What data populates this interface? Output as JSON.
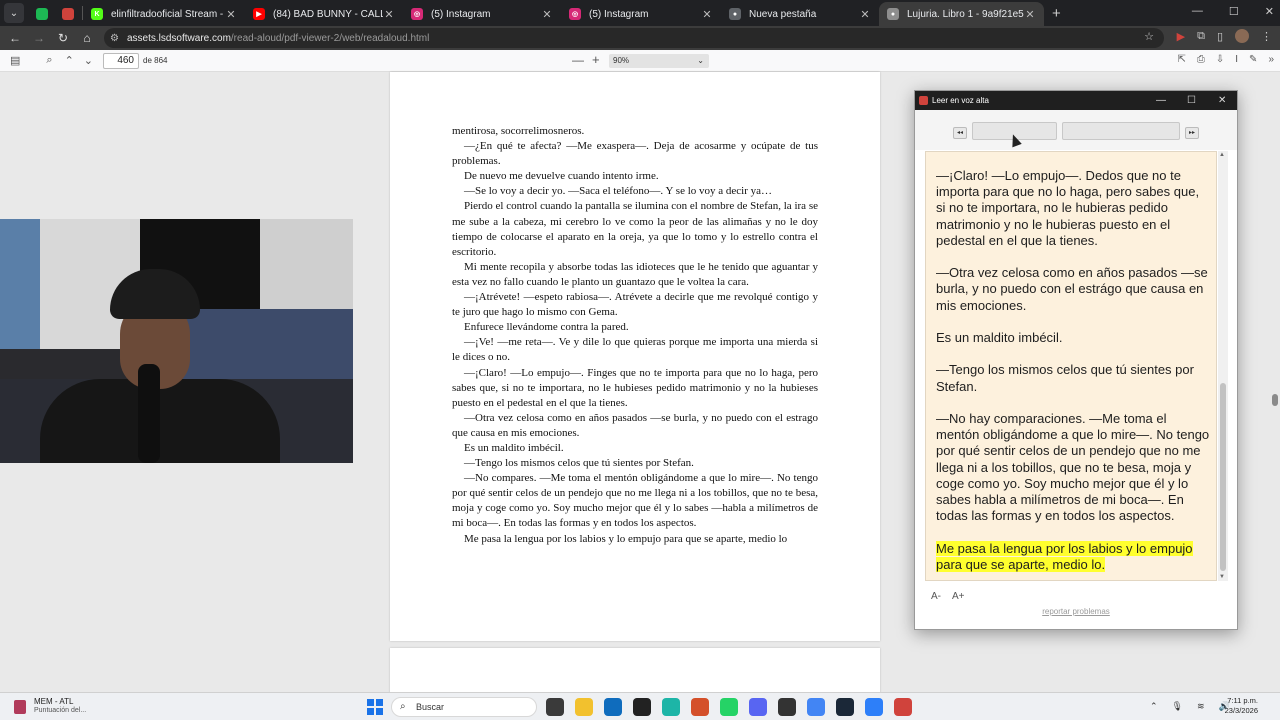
{
  "browser": {
    "tabs": [
      {
        "label": "elinfiltradooficial Stream - Wat",
        "fav_color": "#53fc18",
        "fav_glyph": "K",
        "active": false
      },
      {
        "label": "(84) BAD BUNNY - CALLAÍTA (C",
        "fav_color": "#ff0000",
        "fav_glyph": "▶",
        "active": false
      },
      {
        "label": "(5) Instagram",
        "fav_color": "#d62976",
        "fav_glyph": "◎",
        "active": false
      },
      {
        "label": "(5) Instagram",
        "fav_color": "#d62976",
        "fav_glyph": "◎",
        "active": false
      },
      {
        "label": "Nueva pestaña",
        "fav_color": "#5f6368",
        "fav_glyph": "●",
        "active": false
      },
      {
        "label": "Lujuria. Libro 1 - 9a9f21e5-01d",
        "fav_color": "#8e8e8e",
        "fav_glyph": "●",
        "active": true
      }
    ],
    "url_host": "assets.lsdsoftware.com",
    "url_path": "/read-aloud/pdf-viewer-2/web/readaloud.html"
  },
  "pdf_toolbar": {
    "page_current": "460",
    "page_total": "de 864",
    "zoom": "90%"
  },
  "document": {
    "paragraphs": [
      "mentirosa, socorrelimosneros.",
      "—¿En qué te afecta? —Me exaspera—. Deja de acosarme y ocúpate de tus problemas.",
      "De nuevo me devuelve cuando intento irme.",
      "—Se lo voy a decir yo. —Saca el teléfono—. Y se lo voy a decir ya…",
      "Pierdo el control cuando la pantalla se ilumina con el nombre de Stefan, la ira se me sube a la cabeza, mi cerebro lo ve como la peor de las alimañas y no le doy tiempo de colocarse el aparato en la oreja, ya que lo tomo y lo estrello contra el escritorio.",
      "Mi mente recopila y absorbe todas las idioteces que le he tenido que aguantar y esta vez no fallo cuando le planto un guantazo que le voltea la cara.",
      "—¡Atrévete! —espeto rabiosa—. Atrévete a decirle que me revolqué contigo y te juro que hago lo mismo con Gema.",
      "Enfurece llevándome contra la pared.",
      "—¡Ve! —me reta—. Ve y dile lo que quieras porque me importa una mierda si le dices o no.",
      "—¡Claro! —Lo empujo—. Finges que no te importa para que no lo haga, pero sabes que, si no te importara, no le hubieses pedido matrimonio y no la hubieses puesto en el pedestal en el que la tienes.",
      "—Otra vez celosa como en años pasados —se burla, y no puedo con el estrago que causa en mis emociones.",
      "Es un maldito imbécil.",
      "—Tengo los mismos celos que tú sientes por Stefan.",
      "—No compares. —Me toma el mentón obligándome a que lo mire—. No tengo por qué sentir celos de un pendejo que no me llega ni a los tobillos, que no te besa, moja y coge como yo. Soy mucho mejor que él y lo sabes —habla a milímetros de mi boca—. En todas las formas y en todos los aspectos.",
      "Me pasa la lengua por los labios y lo empujo para que se aparte, medio lo"
    ]
  },
  "read_aloud": {
    "title": "Leer en voz alta",
    "paragraphs": [
      "—¡Claro! —Lo empujo—. Dedos que no te importa para que no lo haga, pero sabes que, si no te importara, no le hubieras pedido matrimonio y no le hubieras puesto en el pedestal en el que la tienes.",
      "—Otra vez celosa como en años pasados —se burla, y no puedo con el estrágo que causa en mis emociones.",
      "Es un maldito imbécil.",
      "—Tengo los mismos celos que tú sientes por Stefan.",
      "—No hay comparaciones. —Me toma el mentón obligándome a que lo mire—. No tengo por qué sentir celos de un pendejo que no me llega ni a los tobillos, que no te besa, moja y coge como yo. Soy mucho mejor que él y lo sabes habla a milímetros de mi boca—. En todas las formas y en todos los aspectos."
    ],
    "highlighted": "Me pasa la lengua por los labios y lo empujo para que se aparte, medio lo.",
    "font_smaller": "A-",
    "font_larger": "A+",
    "report_link": "reportar problemas"
  },
  "taskbar": {
    "weather_title": "MEM - ATL",
    "weather_sub": "Puntuación del...",
    "search_placeholder": "Buscar",
    "time": "7:11 p.m.",
    "date": "23/3/2026",
    "app_colors": [
      "#3a3a3a",
      "#f2c12e",
      "#0f6cbd",
      "#222222",
      "#1db5a7",
      "#d4502a",
      "#25d366",
      "#5865f2",
      "#333333",
      "#4285f4",
      "#1b2838",
      "#2d7ff9",
      "#d0433c"
    ]
  }
}
